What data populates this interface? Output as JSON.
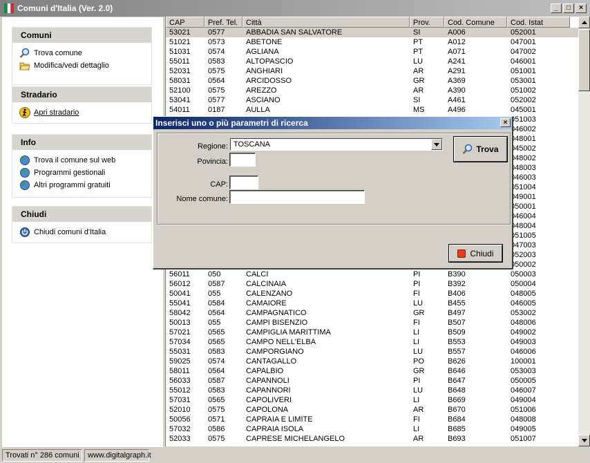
{
  "window": {
    "title": "Comuni d'Italia (Ver. 2.0)",
    "minimize": "_",
    "maximize": "□",
    "close": "×"
  },
  "sidebar": {
    "comuni": {
      "header": "Comuni",
      "items": [
        {
          "label": "Trova comune",
          "icon": "magnifier-icon"
        },
        {
          "label": "Modifica/vedi dettaglio",
          "icon": "folder-open-icon"
        }
      ]
    },
    "stradario": {
      "header": "Stradario",
      "items": [
        {
          "label": "Apri stradario",
          "icon": "pedestrian-icon"
        }
      ]
    },
    "info": {
      "header": "Info",
      "items": [
        {
          "label": "Trova il comune sul web",
          "icon": "globe-icon"
        },
        {
          "label": "Programmi gestionali",
          "icon": "globe-icon"
        },
        {
          "label": "Altri programmi gratuiti",
          "icon": "globe-icon"
        }
      ]
    },
    "chiudi": {
      "header": "Chiudi",
      "items": [
        {
          "label": "Chiudi comuni d'Italia",
          "icon": "power-icon"
        }
      ]
    }
  },
  "grid": {
    "columns": [
      "CAP",
      "Pref. Tel.",
      "Città",
      "Prov.",
      "Cod. Comune",
      "Cod. Istat"
    ],
    "rows": [
      [
        "53021",
        "0577",
        "ABBADIA SAN SALVATORE",
        "SI",
        "A006",
        "052001"
      ],
      [
        "51021",
        "0573",
        "ABETONE",
        "PT",
        "A012",
        "047001"
      ],
      [
        "51031",
        "0574",
        "AGLIANA",
        "PT",
        "A071",
        "047002"
      ],
      [
        "55011",
        "0583",
        "ALTOPASCIO",
        "LU",
        "A241",
        "046001"
      ],
      [
        "52031",
        "0575",
        "ANGHIARI",
        "AR",
        "A291",
        "051001"
      ],
      [
        "58031",
        "0564",
        "ARCIDOSSO",
        "GR",
        "A369",
        "053001"
      ],
      [
        "52100",
        "0575",
        "AREZZO",
        "AR",
        "A390",
        "051002"
      ],
      [
        "53041",
        "0577",
        "ASCIANO",
        "SI",
        "A461",
        "052002"
      ],
      [
        "54011",
        "0187",
        "AULLA",
        "MS",
        "A496",
        "045001"
      ],
      [
        "",
        "",
        "",
        "",
        "",
        "051003"
      ],
      [
        "",
        "",
        "",
        "",
        "",
        "046002"
      ],
      [
        "",
        "",
        "",
        "",
        "",
        "048001"
      ],
      [
        "",
        "",
        "",
        "",
        "",
        "045002"
      ],
      [
        "",
        "",
        "",
        "",
        "",
        "048002"
      ],
      [
        "",
        "",
        "",
        "",
        "",
        "048003"
      ],
      [
        "",
        "",
        "",
        "",
        "",
        "046003"
      ],
      [
        "",
        "",
        "",
        "",
        "",
        "051004"
      ],
      [
        "",
        "",
        "",
        "",
        "",
        "049001"
      ],
      [
        "",
        "",
        "",
        "",
        "",
        "050001"
      ],
      [
        "",
        "",
        "",
        "",
        "",
        "046004"
      ],
      [
        "",
        "",
        "",
        "",
        "",
        "048004"
      ],
      [
        "",
        "",
        "",
        "",
        "",
        "051005"
      ],
      [
        "",
        "",
        "",
        "",
        "",
        "047003"
      ],
      [
        "",
        "",
        "",
        "",
        "",
        "052003"
      ],
      [
        "",
        "",
        "",
        "",
        "",
        "050002"
      ],
      [
        "56011",
        "050",
        "CALCI",
        "PI",
        "B390",
        "050003"
      ],
      [
        "56012",
        "0587",
        "CALCINAIA",
        "PI",
        "B392",
        "050004"
      ],
      [
        "50041",
        "055",
        "CALENZANO",
        "FI",
        "B406",
        "048005"
      ],
      [
        "55041",
        "0584",
        "CAMAIORE",
        "LU",
        "B455",
        "046005"
      ],
      [
        "58042",
        "0564",
        "CAMPAGNATICO",
        "GR",
        "B497",
        "053002"
      ],
      [
        "50013",
        "055",
        "CAMPI BISENZIO",
        "FI",
        "B507",
        "048006"
      ],
      [
        "57021",
        "0565",
        "CAMPIGLIA MARITTIMA",
        "LI",
        "B509",
        "049002"
      ],
      [
        "57034",
        "0565",
        "CAMPO NELL'ELBA",
        "LI",
        "B553",
        "049003"
      ],
      [
        "55031",
        "0583",
        "CAMPORGIANO",
        "LU",
        "B557",
        "046006"
      ],
      [
        "59025",
        "0574",
        "CANTAGALLO",
        "PO",
        "B626",
        "100001"
      ],
      [
        "58011",
        "0564",
        "CAPALBIO",
        "GR",
        "B646",
        "053003"
      ],
      [
        "56033",
        "0587",
        "CAPANNOLI",
        "PI",
        "B647",
        "050005"
      ],
      [
        "55012",
        "0583",
        "CAPANNORI",
        "LU",
        "B648",
        "046007"
      ],
      [
        "57031",
        "0565",
        "CAPOLIVERI",
        "LI",
        "B669",
        "049004"
      ],
      [
        "52010",
        "0575",
        "CAPOLONA",
        "AR",
        "B670",
        "051006"
      ],
      [
        "50056",
        "0571",
        "CAPRAIA E LIMITE",
        "FI",
        "B684",
        "048008"
      ],
      [
        "57032",
        "0586",
        "CAPRAIA ISOLA",
        "LI",
        "B685",
        "049005"
      ],
      [
        "52033",
        "0575",
        "CAPRESE MICHELANGELO",
        "AR",
        "B693",
        "051007"
      ]
    ]
  },
  "status": {
    "found": "Trovati n° 286 comuni",
    "site": "www.digitalgraph.it"
  },
  "dialog": {
    "title": "Inserisci uno o più parametri di ricerca",
    "close": "×",
    "regione_label": "Regione:",
    "regione_value": "TOSCANA",
    "provincia_label": "Povincia:",
    "provincia_value": "",
    "cap_label": "CAP:",
    "cap_value": "",
    "nome_label": "Nome comune:",
    "nome_value": "",
    "trova_label": "Trova",
    "chiudi_label": "Chiudi"
  }
}
